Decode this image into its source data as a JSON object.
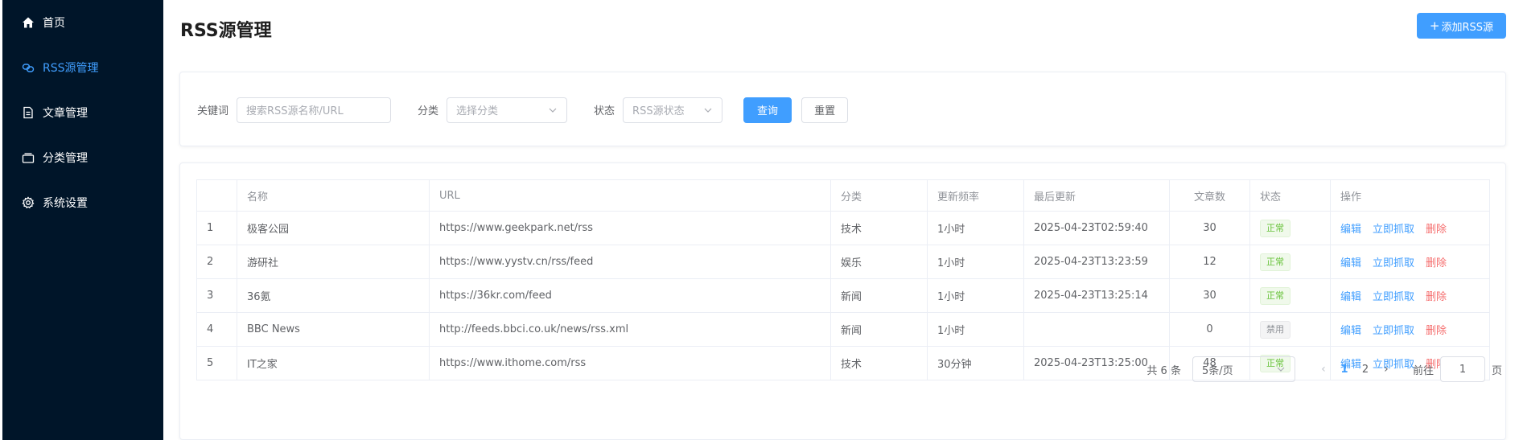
{
  "sidebar": {
    "items": [
      {
        "label": "首页",
        "icon": "home-icon"
      },
      {
        "label": "RSS源管理",
        "icon": "rss-link-icon",
        "active": true
      },
      {
        "label": "文章管理",
        "icon": "document-icon"
      },
      {
        "label": "分类管理",
        "icon": "folder-icon"
      },
      {
        "label": "系统设置",
        "icon": "gear-icon"
      }
    ]
  },
  "header": {
    "title": "RSS源管理",
    "add_button": "添加RSS源",
    "add_icon": "plus-icon"
  },
  "filters": {
    "keyword_label": "关键词",
    "keyword_placeholder": "搜索RSS源名称/URL",
    "category_label": "分类",
    "category_placeholder": "选择分类",
    "status_label": "状态",
    "status_placeholder": "RSS源状态",
    "search_button": "查询",
    "reset_button": "重置"
  },
  "table": {
    "columns": [
      "",
      "名称",
      "URL",
      "分类",
      "更新频率",
      "最后更新",
      "文章数",
      "状态",
      "操作"
    ],
    "rows": [
      {
        "index": "1",
        "name": "极客公园",
        "url": "https://www.geekpark.net/rss",
        "category": "技术",
        "frequency": "1小时",
        "last_update": "2025-04-23T02:59:40",
        "articles": "30",
        "status": "正常"
      },
      {
        "index": "2",
        "name": "游研社",
        "url": "https://www.yystv.cn/rss/feed",
        "category": "娱乐",
        "frequency": "1小时",
        "last_update": "2025-04-23T13:23:59",
        "articles": "12",
        "status": "正常"
      },
      {
        "index": "3",
        "name": "36氪",
        "url": "https://36kr.com/feed",
        "category": "新闻",
        "frequency": "1小时",
        "last_update": "2025-04-23T13:25:14",
        "articles": "30",
        "status": "正常"
      },
      {
        "index": "4",
        "name": "BBC News",
        "url": "http://feeds.bbci.co.uk/news/rss.xml",
        "category": "新闻",
        "frequency": "1小时",
        "last_update": "",
        "articles": "0",
        "status": "禁用"
      },
      {
        "index": "5",
        "name": "IT之家",
        "url": "https://www.ithome.com/rss",
        "category": "技术",
        "frequency": "30分钟",
        "last_update": "2025-04-23T13:25:00",
        "articles": "48",
        "status": "正常"
      }
    ],
    "actions": {
      "edit": "编辑",
      "fetch": "立即抓取",
      "delete": "删除"
    }
  },
  "pagination": {
    "total": "共 6 条",
    "page_size": "5条/页",
    "pages": [
      "1",
      "2"
    ],
    "current": "1",
    "goto_label": "前往",
    "goto_value": "1",
    "page_suffix": "页"
  },
  "colors": {
    "sidebar_bg": "#001529",
    "accent": "#409eff",
    "success": "#67c23a",
    "danger": "#f56c6c",
    "disabled": "#909399"
  }
}
